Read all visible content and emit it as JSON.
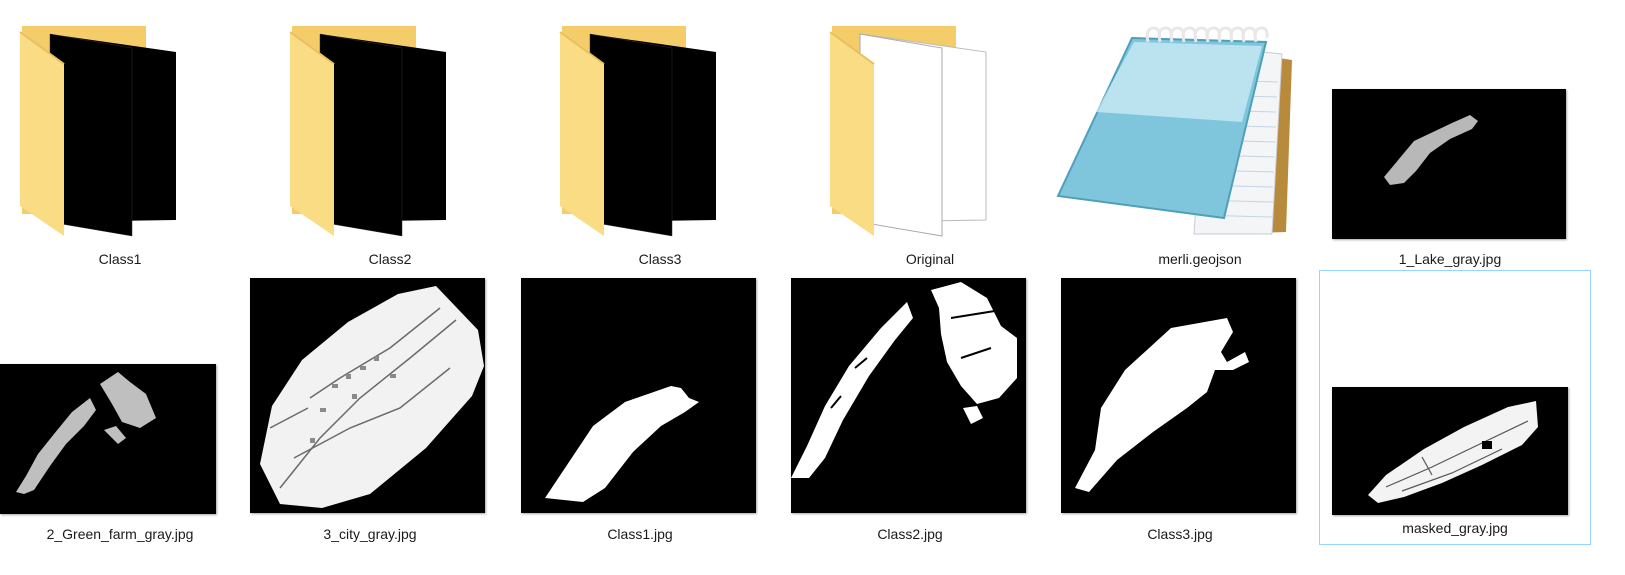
{
  "items": [
    {
      "label": "Class1",
      "kind": "folder"
    },
    {
      "label": "Class2",
      "kind": "folder"
    },
    {
      "label": "Class3",
      "kind": "folder"
    },
    {
      "label": "Original",
      "kind": "folder"
    },
    {
      "label": "merli.geojson",
      "kind": "file"
    },
    {
      "label": "1_Lake_gray.jpg",
      "kind": "image"
    },
    {
      "label": "2_Green_farm_gray.jpg",
      "kind": "image"
    },
    {
      "label": "3_city_gray.jpg",
      "kind": "image"
    },
    {
      "label": "Class1.jpg",
      "kind": "image"
    },
    {
      "label": "Class2.jpg",
      "kind": "image"
    },
    {
      "label": "Class3.jpg",
      "kind": "image"
    },
    {
      "label": "masked_gray.jpg",
      "kind": "image"
    }
  ],
  "colors": {
    "folder_front": "#f9dc84",
    "folder_back": "#f2c65a",
    "selection": "#99d1ff"
  }
}
